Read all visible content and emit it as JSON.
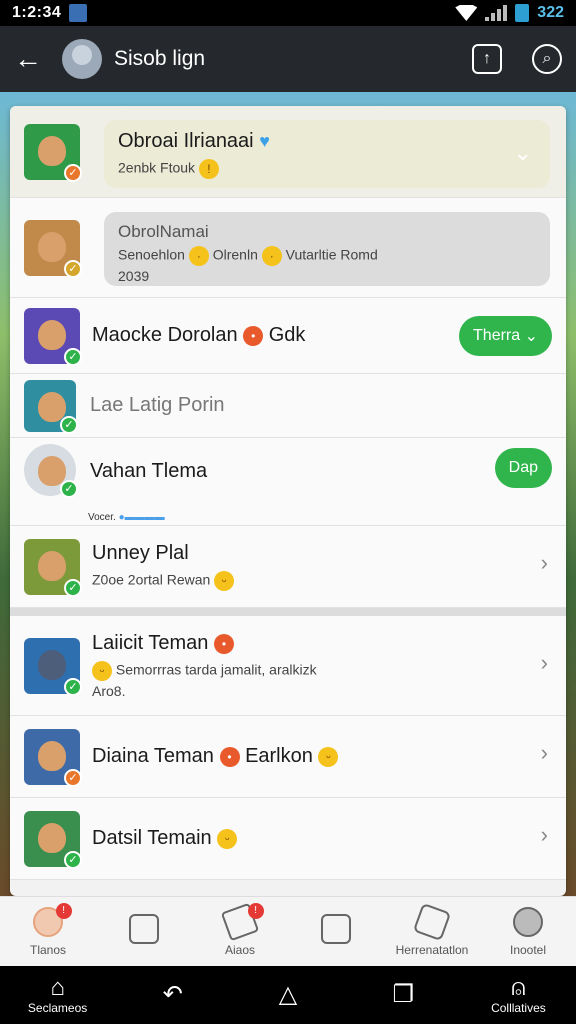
{
  "status": {
    "time": "1:2:34",
    "battery": "322"
  },
  "appbar": {
    "title": "Sisob lign"
  },
  "contacts": [
    {
      "name": "Obroai Ilrianaai",
      "sub": "2enbk Ftouk"
    },
    {
      "name": "ObrolNamai",
      "sub": "Senoehlon",
      "sub2": "Olrenln",
      "sub3": "Vutarltie Romd",
      "sub4": "2039"
    },
    {
      "name": "Maocke Dorolan",
      "tail": "Gdk",
      "action": "Therra"
    },
    {
      "name": "Lae Latig Porin"
    },
    {
      "name": "Vahan Tlema",
      "action": "Dap",
      "typing": "Vocer."
    },
    {
      "name": "Unney Plal",
      "sub": "Z0oe 2ortal Rewan"
    },
    {
      "name": "Laiicit Teman",
      "sub": "Semorrras tarda jamalit, aralkizk",
      "sub2": "Aro8."
    },
    {
      "name": "Diaina Teman",
      "tail": "Earlkon"
    },
    {
      "name": "Datsil Temain"
    }
  ],
  "bottom_nav": [
    "Tlanos",
    "",
    "Aiaos",
    "",
    "Herrenatatlon",
    "Inootel"
  ],
  "system_nav": {
    "left_label": "Seclameos",
    "right_label": "Colllatives"
  }
}
